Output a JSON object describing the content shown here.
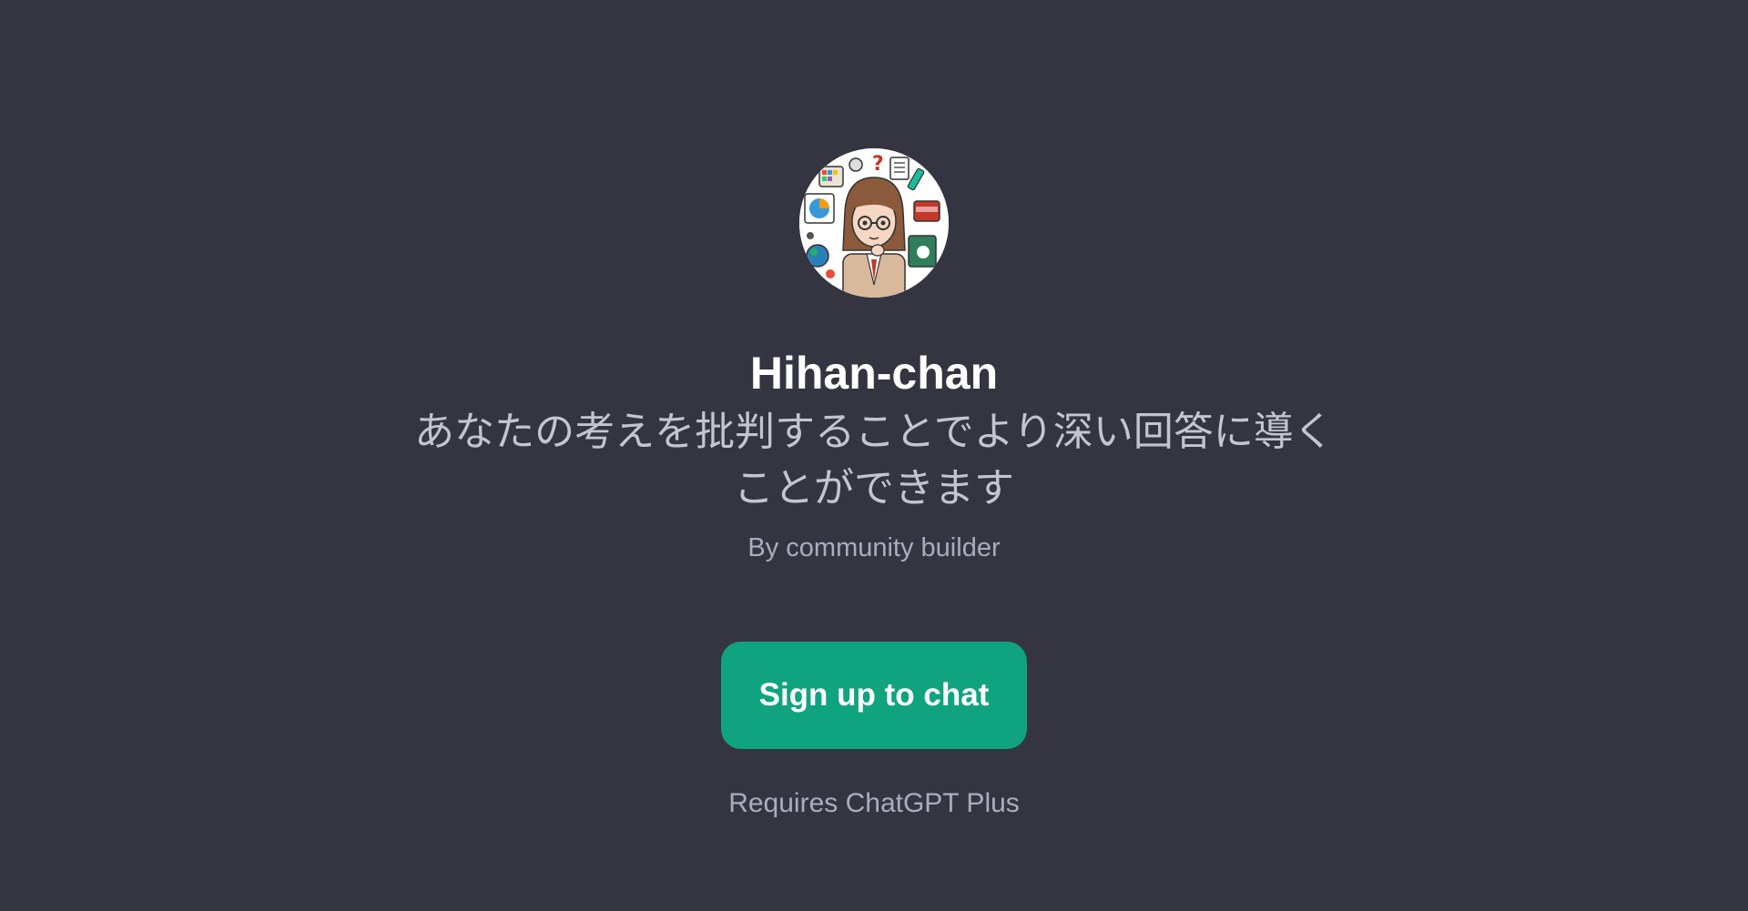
{
  "gpt": {
    "name": "Hihan-chan",
    "description": "あなたの考えを批判することでより深い回答に導くことができます",
    "author": "By community builder",
    "avatar_icon": "cartoon-girl-glasses-avatar"
  },
  "actions": {
    "signup_label": "Sign up to chat"
  },
  "footer": {
    "requirement": "Requires ChatGPT Plus"
  },
  "colors": {
    "background": "#343541",
    "accent": "#10a37f",
    "title": "#ffffff",
    "muted": "#acacbe"
  }
}
